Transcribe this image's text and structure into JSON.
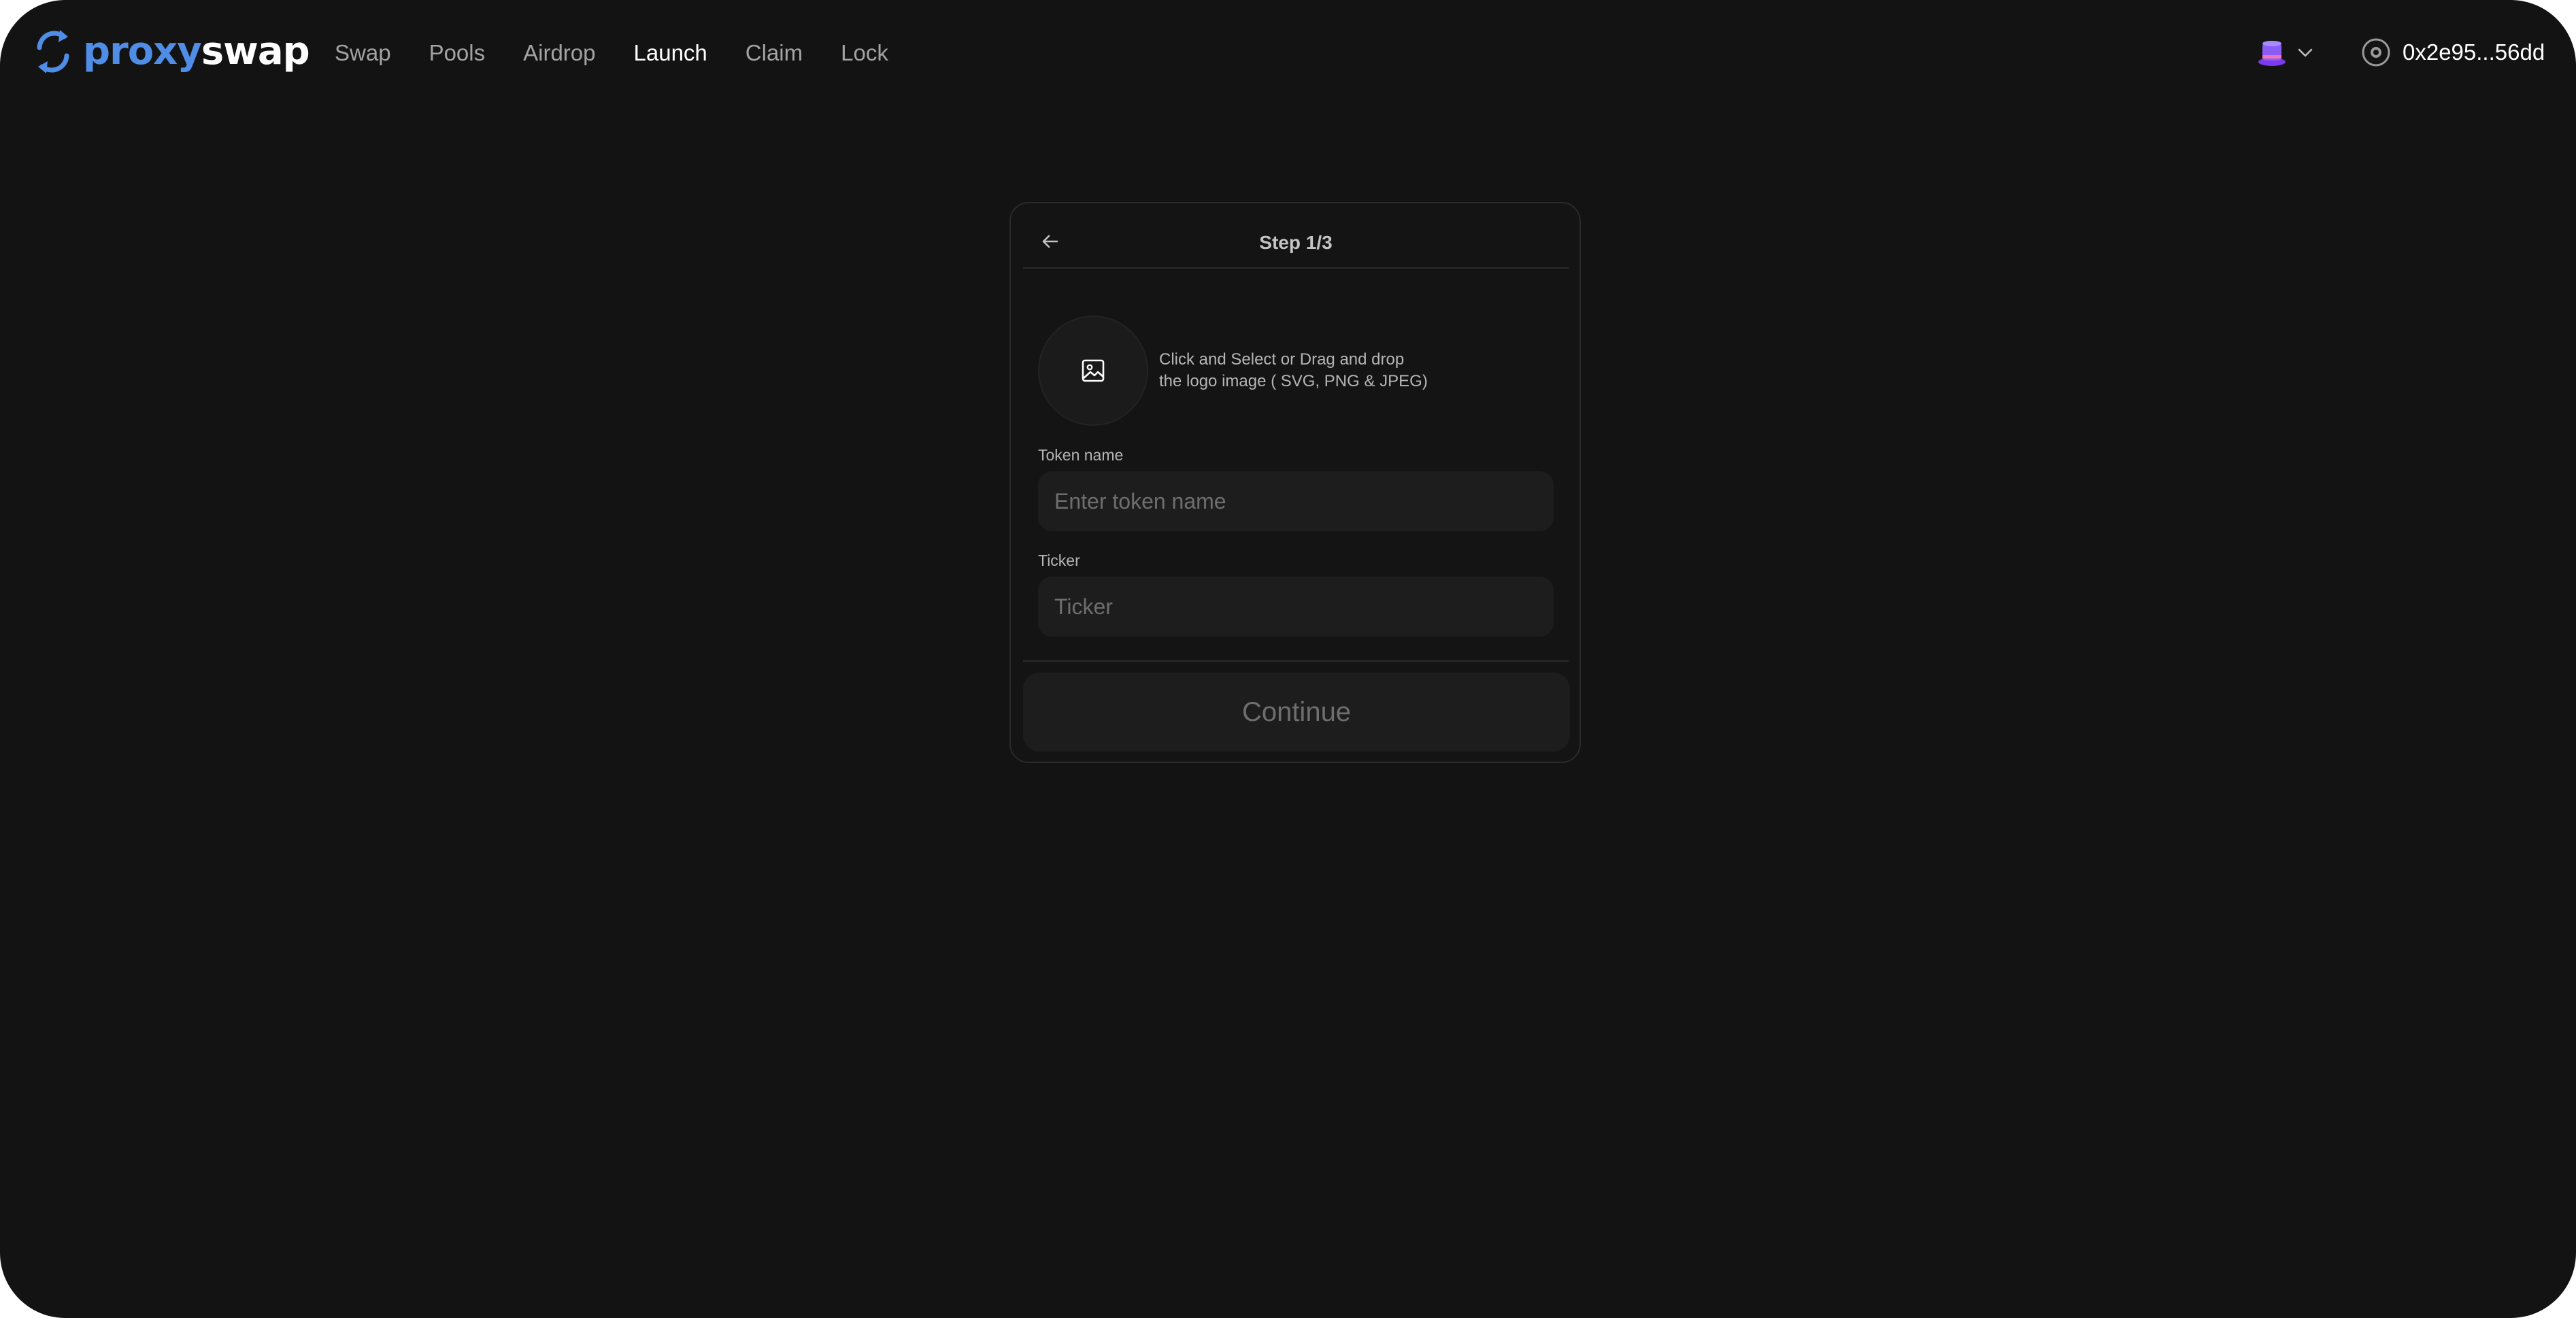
{
  "header": {
    "logo": {
      "text_part1": "proxy",
      "text_part2": "swap",
      "icon": "swap-arrows-icon",
      "brand_color": "#4f8de6"
    },
    "nav": [
      {
        "label": "Swap",
        "active": false
      },
      {
        "label": "Pools",
        "active": false
      },
      {
        "label": "Airdrop",
        "active": false
      },
      {
        "label": "Launch",
        "active": true
      },
      {
        "label": "Claim",
        "active": false
      },
      {
        "label": "Lock",
        "active": false
      }
    ],
    "chain_selector": {
      "icon": "chain-hat-icon",
      "icon_color": "#8b5cf6"
    },
    "wallet": {
      "icon": "wallet-icon",
      "address": "0x2e95...56dd"
    }
  },
  "card": {
    "title": "Step 1/3",
    "back_icon": "arrow-left-icon",
    "upload": {
      "icon": "image-icon",
      "line1": "Click and Select or Drag and drop",
      "line2": "the logo image ( SVG, PNG & JPEG)"
    },
    "token_name": {
      "label": "Token name",
      "placeholder": "Enter token name",
      "value": ""
    },
    "ticker": {
      "label": "Ticker",
      "placeholder": "Ticker",
      "value": ""
    },
    "continue_label": "Continue"
  },
  "colors": {
    "background": "#131313",
    "card_border": "#2a2a2a",
    "input_bg": "#1d1d1d",
    "muted_text": "#6e6e6e"
  }
}
